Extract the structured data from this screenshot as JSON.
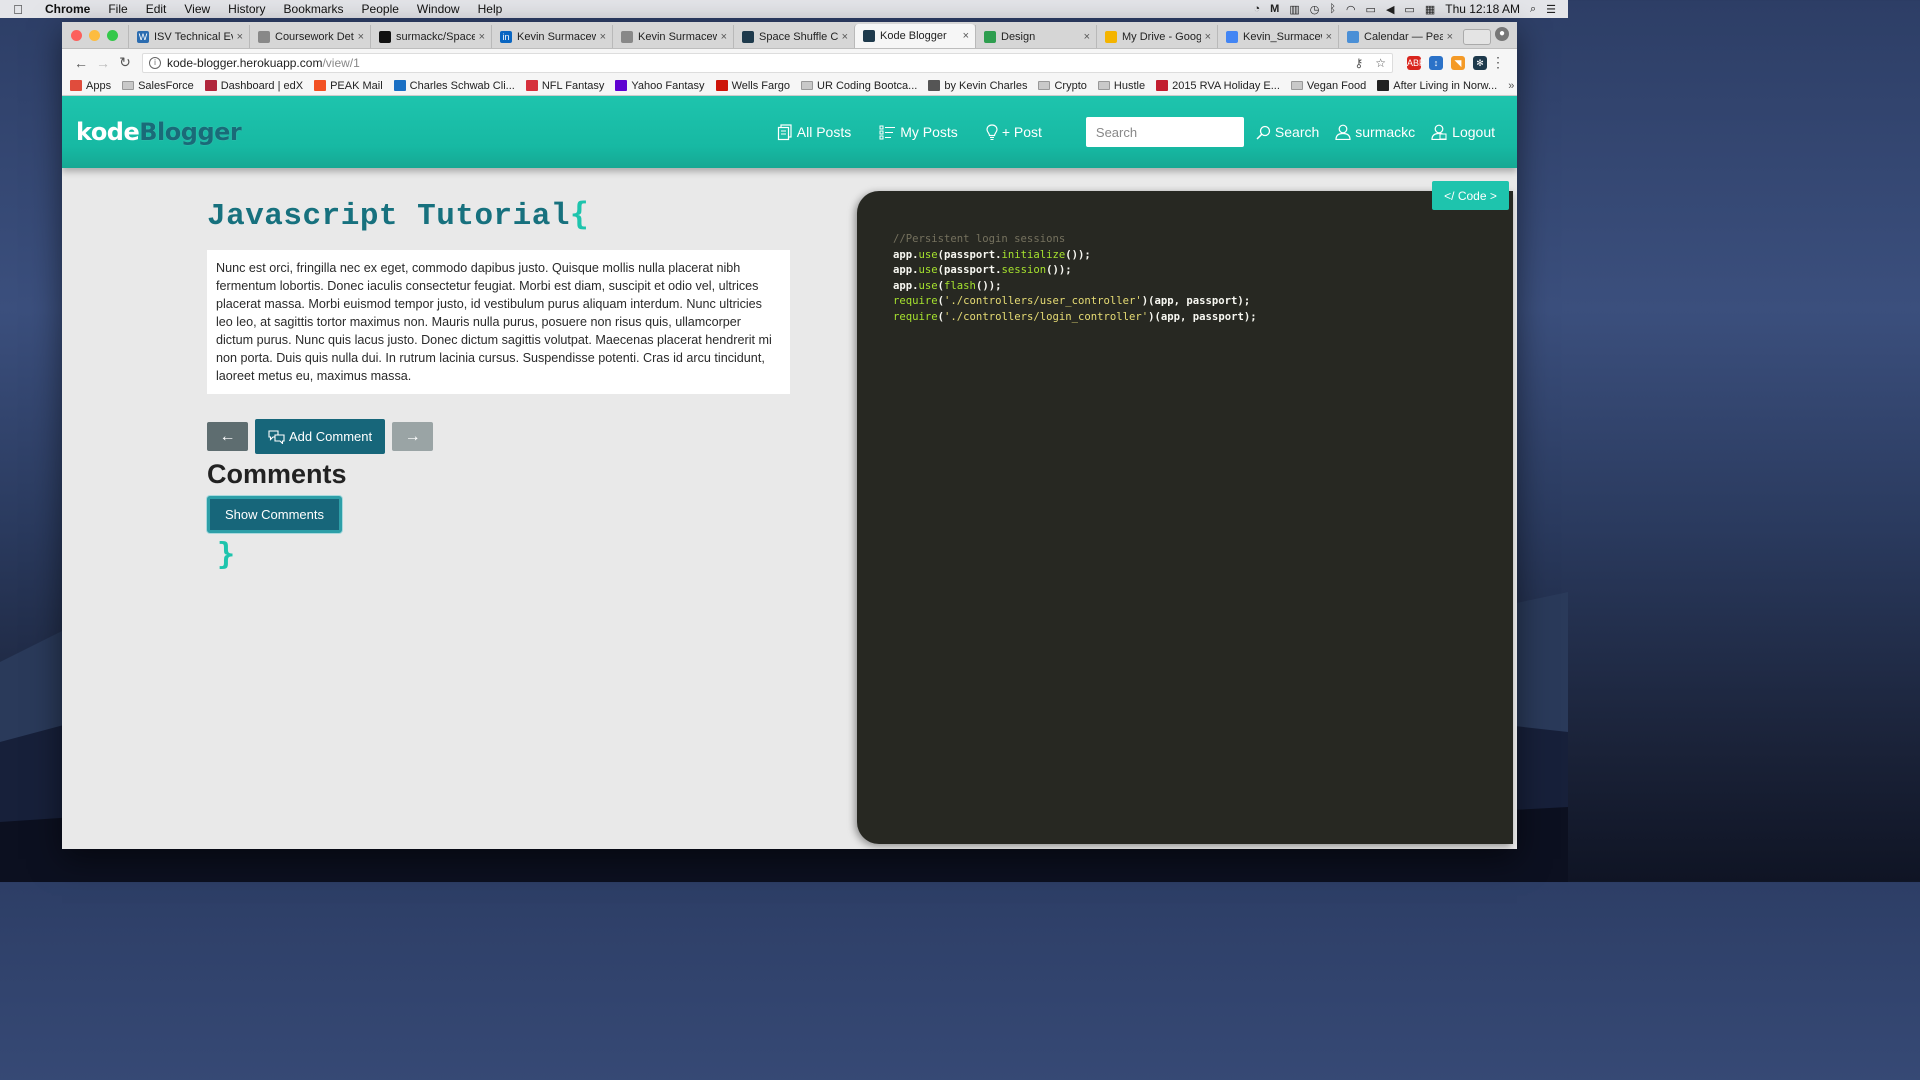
{
  "menubar": {
    "app": "Chrome",
    "items": [
      "File",
      "Edit",
      "View",
      "History",
      "Bookmarks",
      "People",
      "Window",
      "Help"
    ],
    "clock": "Thu 12:18 AM"
  },
  "tabs": [
    {
      "title": "ISV Technical Ev",
      "fav_color": "#2b6cb0",
      "fav_glyph": "W"
    },
    {
      "title": "Coursework Det",
      "fav_color": "#888888",
      "fav_glyph": ""
    },
    {
      "title": "surmackc/Space",
      "fav_color": "#111111",
      "fav_glyph": ""
    },
    {
      "title": "Kevin Surmacew",
      "fav_color": "#0a66c2",
      "fav_glyph": "in"
    },
    {
      "title": "Kevin Surmacew",
      "fav_color": "#888888",
      "fav_glyph": ""
    },
    {
      "title": "Space Shuffle C",
      "fav_color": "#1e3a4c",
      "fav_glyph": ""
    },
    {
      "title": "Kode Blogger",
      "fav_color": "#1e3a4c",
      "fav_glyph": "",
      "active": true
    },
    {
      "title": "Design",
      "fav_color": "#2e9e4f",
      "fav_glyph": ""
    },
    {
      "title": "My Drive - Goog",
      "fav_color": "#f4b400",
      "fav_glyph": ""
    },
    {
      "title": "Kevin_Surmacew",
      "fav_color": "#4285f4",
      "fav_glyph": ""
    },
    {
      "title": "Calendar — Peal",
      "fav_color": "#4a8fd6",
      "fav_glyph": ""
    }
  ],
  "toolbar": {
    "url_host": "kode-blogger.herokuapp.com",
    "url_path": "/view/1"
  },
  "bookmarks": [
    {
      "label": "Apps",
      "color": "#e04c3c",
      "folder": false
    },
    {
      "label": "SalesForce",
      "color": "",
      "folder": true
    },
    {
      "label": "Dashboard | edX",
      "color": "#b0263c",
      "folder": false
    },
    {
      "label": "PEAK Mail",
      "color": "#f25022",
      "folder": false
    },
    {
      "label": "Charles Schwab Cli...",
      "color": "#1a6fc4",
      "folder": false
    },
    {
      "label": "NFL Fantasy",
      "color": "#d6303c",
      "folder": false
    },
    {
      "label": "Yahoo Fantasy",
      "color": "#5f01d1",
      "folder": false
    },
    {
      "label": "Wells Fargo",
      "color": "#cd1409",
      "folder": false
    },
    {
      "label": "UR Coding Bootca...",
      "color": "",
      "folder": true
    },
    {
      "label": "by Kevin Charles",
      "color": "#555555",
      "folder": false
    },
    {
      "label": "Crypto",
      "color": "",
      "folder": true
    },
    {
      "label": "Hustle",
      "color": "",
      "folder": true
    },
    {
      "label": "2015 RVA Holiday E...",
      "color": "#c21d2f",
      "folder": false
    },
    {
      "label": "Vegan Food",
      "color": "",
      "folder": true
    },
    {
      "label": "After Living in Norw...",
      "color": "#222222",
      "folder": false
    }
  ],
  "site": {
    "logo_part1": "kode",
    "logo_part2": "Blogger",
    "nav": {
      "all_posts": "All Posts",
      "my_posts": "My Posts",
      "new_post": "+ Post",
      "search_placeholder": "Search",
      "search_btn": "Search",
      "user": "surmackc",
      "logout": "Logout"
    },
    "post": {
      "title": "Javascript Tutorial",
      "open_brace": "{",
      "close_brace": "}",
      "body": "Nunc est orci, fringilla nec ex eget, commodo dapibus justo. Quisque mollis nulla placerat nibh fermentum lobortis. Donec iaculis consectetur feugiat. Morbi est diam, suscipit et odio vel, ultrices placerat massa. Morbi euismod tempor justo, id vestibulum purus aliquam interdum. Nunc ultricies leo leo, at sagittis tortor maximus non. Mauris nulla purus, posuere non risus quis, ullamcorper dictum purus. Nunc quis lacus justo. Donec dictum sagittis volutpat. Maecenas placerat hendrerit mi non porta. Duis quis nulla dui. In rutrum lacinia cursus. Suspendisse potenti. Cras id arcu tincidunt, laoreet metus eu, maximus massa."
    },
    "buttons": {
      "prev": "←",
      "add_comment": "Add Comment",
      "next": "→",
      "show_comments": "Show Comments"
    },
    "comments_heading": "Comments",
    "code_toggle": "</ Code >",
    "code": {
      "comment": "//Persistent login sessions",
      "lines": [
        {
          "obj": "app",
          "method": "use",
          "arg_obj": "passport",
          "arg_fn": "initialize",
          "tail": "());"
        },
        {
          "obj": "app",
          "method": "use",
          "arg_obj": "passport",
          "arg_fn": "session",
          "tail": "());"
        },
        {
          "obj": "app",
          "method": "use",
          "arg_fn": "flash",
          "tail": "());"
        },
        {
          "fn": "require",
          "str": "'./controllers/user_controller'",
          "tail": "(app, passport);"
        },
        {
          "fn": "require",
          "str": "'./controllers/login_controller'",
          "tail": "(app, passport);"
        }
      ]
    }
  },
  "colors": {
    "brand_teal": "#1ec4ad",
    "brand_dark": "#17667a",
    "code_bg": "#272822"
  }
}
